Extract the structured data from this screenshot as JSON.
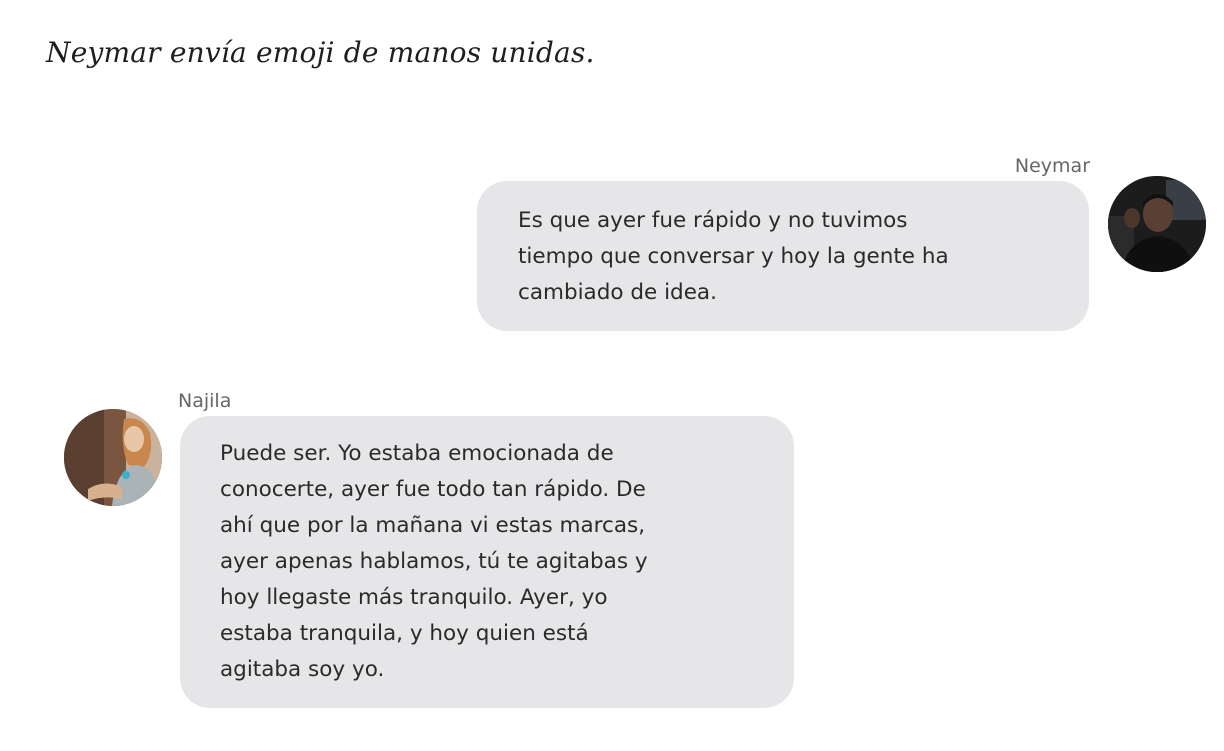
{
  "heading": "Neymar envía emoji de manos unidas.",
  "messages": [
    {
      "sender": "Neymar",
      "text": "Es que ayer fue rápido y no tuvimos\ntiempo que conversar y hoy la gente ha\ncambiado de idea."
    },
    {
      "sender": "Najila",
      "text": "Puede ser. Yo estaba emocionada de\nconocerte, ayer fue todo tan rápido. De\nahí que por la mañana vi estas marcas,\nayer apenas hablamos, tú te agitabas y\nhoy llegaste más tranquilo. Ayer, yo\nestaba tranquila, y hoy quien está\nagitaba soy yo."
    }
  ],
  "colors": {
    "bubble": "#e6e6e8",
    "text": "#2a2a2a",
    "sender_label": "#666666"
  }
}
